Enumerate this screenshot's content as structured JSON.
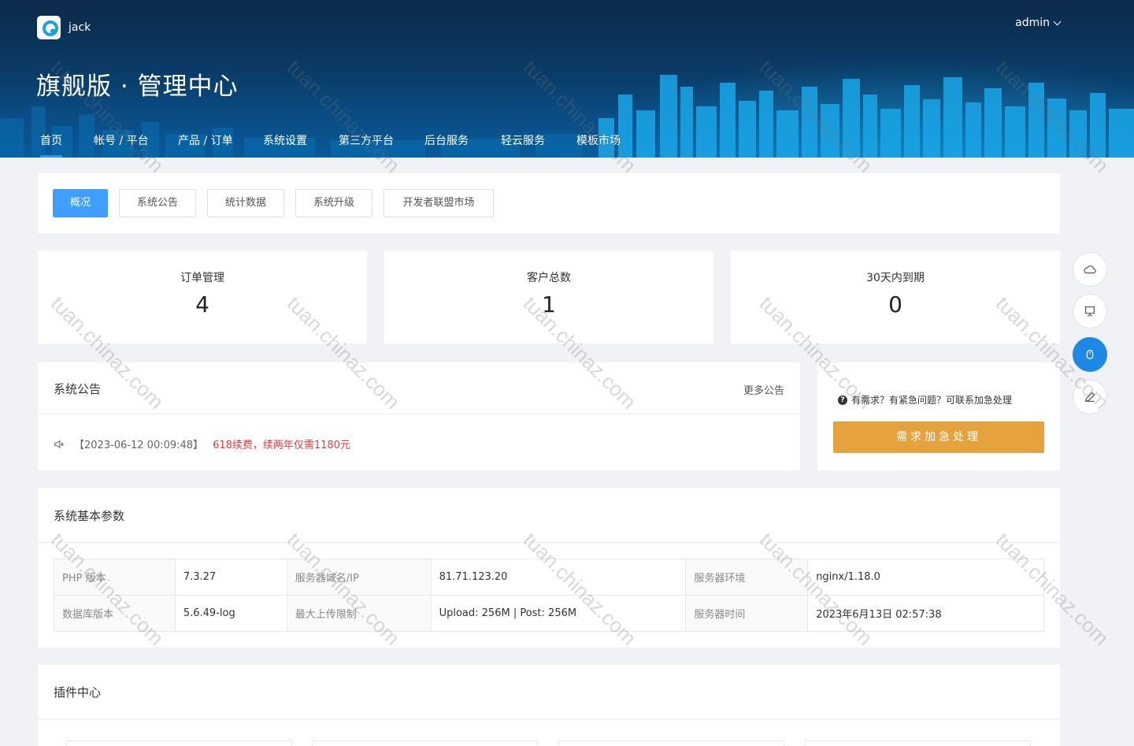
{
  "header": {
    "brand_name": "jack",
    "user_name": "admin",
    "title": "旗舰版 · 管理中心",
    "nav": [
      {
        "label": "首页",
        "active": true
      },
      {
        "label": "帐号 / 平台"
      },
      {
        "label": "产品 / 订单"
      },
      {
        "label": "系统设置"
      },
      {
        "label": "第三方平台"
      },
      {
        "label": "后台服务"
      },
      {
        "label": "轻云服务"
      },
      {
        "label": "模板市场"
      }
    ]
  },
  "tabs": [
    {
      "label": "概况",
      "active": true
    },
    {
      "label": "系统公告"
    },
    {
      "label": "统计数据"
    },
    {
      "label": "系统升级"
    },
    {
      "label": "开发者联盟市场"
    }
  ],
  "stats": [
    {
      "label": "订单管理",
      "value": "4"
    },
    {
      "label": "客户总数",
      "value": "1"
    },
    {
      "label": "30天内到期",
      "value": "0"
    }
  ],
  "notice": {
    "title": "系统公告",
    "more": "更多公告",
    "date": "【2023-06-12 00:09:48】",
    "text": "618续费，续两年仅需1180元"
  },
  "help": {
    "text": "有需求？有紧急问题？可联系加急处理",
    "button": "需求加急处理"
  },
  "params": {
    "title": "系统基本参数",
    "rows": [
      [
        "PHP 版本",
        "7.3.27",
        "服务器域名/IP",
        "81.71.123.20",
        "服务器环境",
        "nginx/1.18.0"
      ],
      [
        "数据库版本",
        "5.6.49-log",
        "最大上传限制",
        "Upload: 256M | Post: 256M",
        "服务器时间",
        "2023年6月13日 02:57:38"
      ]
    ]
  },
  "plugins": {
    "title": "插件中心"
  },
  "watermark": "tuan.chinaz.com",
  "colors": {
    "accent": "#409eff",
    "warning": "#e6a23c",
    "danger": "#e4393c",
    "header_bg": "#0a3b66"
  },
  "side_buttons": [
    "cloud-icon",
    "presentation-icon",
    "mouse-icon",
    "edit-icon"
  ]
}
